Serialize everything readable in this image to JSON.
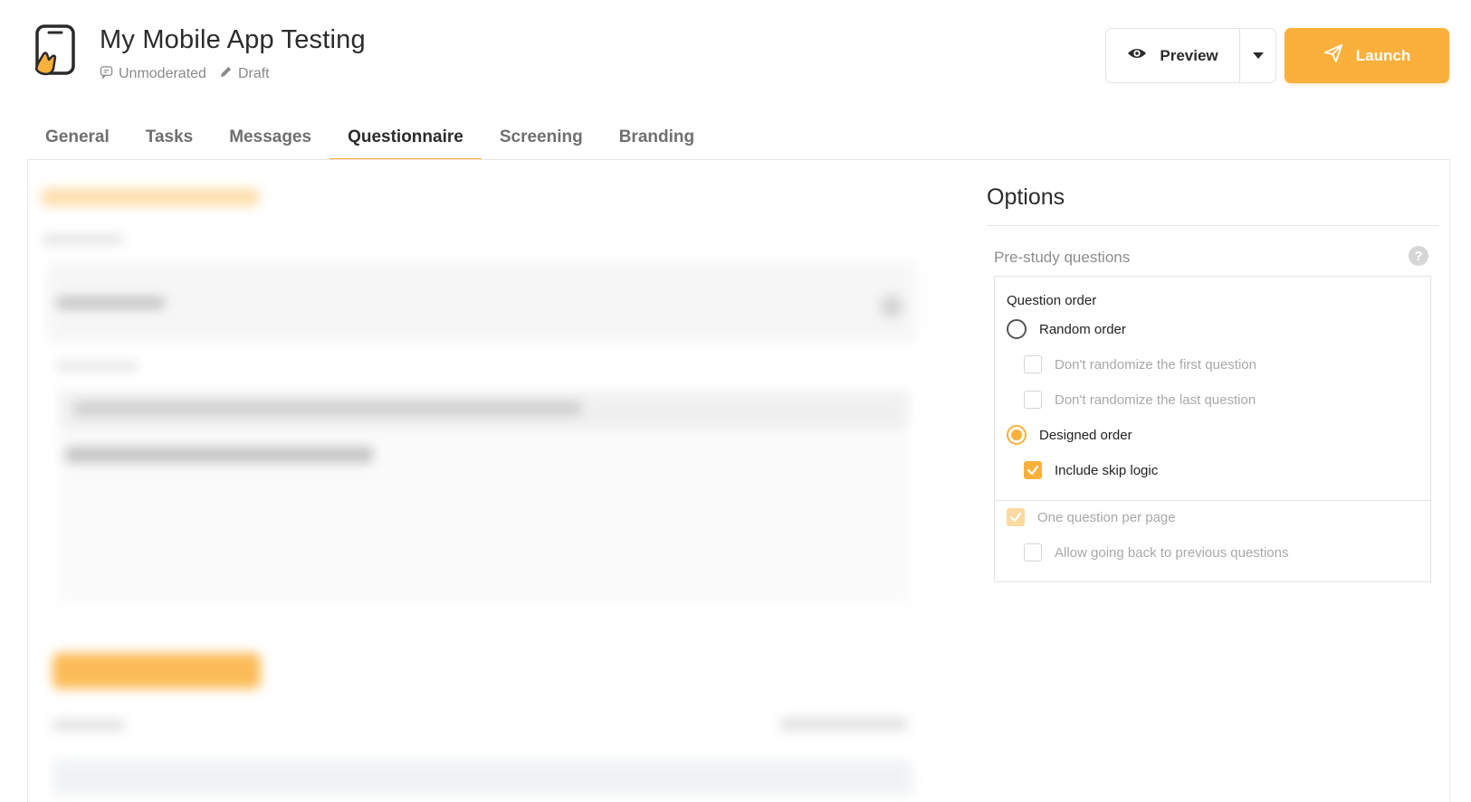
{
  "header": {
    "title": "My Mobile App Testing",
    "mode": "Unmoderated",
    "status": "Draft",
    "preview_label": "Preview",
    "launch_label": "Launch"
  },
  "tabs": [
    {
      "label": "General",
      "active": false
    },
    {
      "label": "Tasks",
      "active": false
    },
    {
      "label": "Messages",
      "active": false
    },
    {
      "label": "Questionnaire",
      "active": true
    },
    {
      "label": "Screening",
      "active": false
    },
    {
      "label": "Branding",
      "active": false
    }
  ],
  "options": {
    "title": "Options",
    "section_label": "Pre-study questions",
    "help": "?",
    "question_order_label": "Question order",
    "random_order": {
      "label": "Random order",
      "selected": false
    },
    "dont_randomize_first": {
      "label": "Don't randomize the first question",
      "checked": false
    },
    "dont_randomize_last": {
      "label": "Don't randomize the last question",
      "checked": false
    },
    "designed_order": {
      "label": "Designed order",
      "selected": true
    },
    "include_skip_logic": {
      "label": "Include skip logic",
      "checked": true
    },
    "one_question_per_page": {
      "label": "One question per page",
      "checked": true
    },
    "allow_going_back": {
      "label": "Allow going back to previous questions",
      "checked": false
    }
  },
  "colors": {
    "accent": "#fbb03b",
    "text_dark": "#2b2b2b",
    "text_muted": "#8a8a8a",
    "border": "#e4e4e4"
  }
}
